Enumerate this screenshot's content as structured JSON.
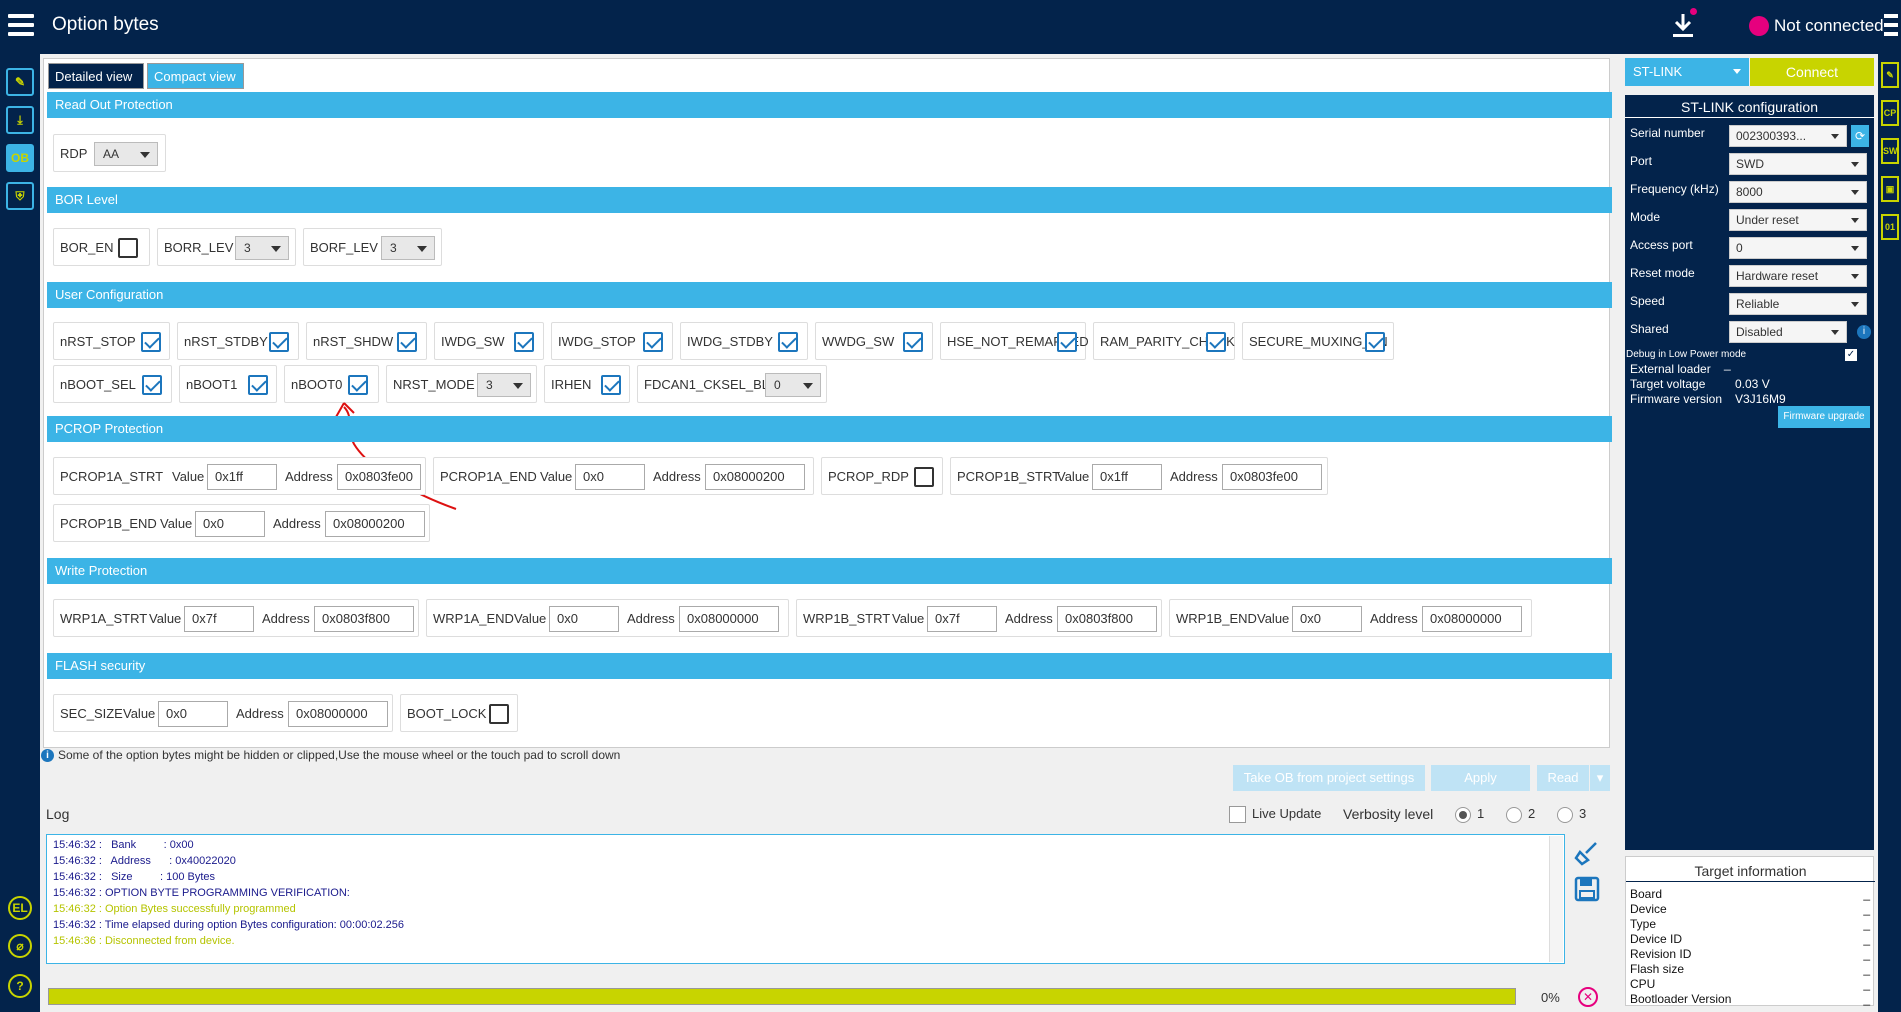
{
  "header": {
    "title": "Option bytes",
    "connection_status": "Not connected"
  },
  "tabs": {
    "detailed": "Detailed view",
    "compact": "Compact view"
  },
  "sections": {
    "rdp": "Read Out Protection",
    "bor": "BOR Level",
    "user": "User Configuration",
    "pcrop": "PCROP Protection",
    "wrp": "Write Protection",
    "flash": "FLASH security"
  },
  "rdp": {
    "label": "RDP",
    "value": "AA"
  },
  "bor": {
    "bor_en": "BOR_EN",
    "borr_lev": "BORR_LEV",
    "borr_val": "3",
    "borf_lev": "BORF_LEV",
    "borf_val": "3"
  },
  "user": {
    "row1": [
      "nRST_STOP",
      "nRST_STDBY",
      "nRST_SHDW",
      "IWDG_SW",
      "IWDG_STOP",
      "IWDG_STDBY",
      "WWDG_SW",
      "HSE_NOT_REMAPPED",
      "RAM_PARITY_CHECK",
      "SECURE_MUXING_EN"
    ],
    "nboot_sel": "nBOOT_SEL",
    "nboot1": "nBOOT1",
    "nboot0": "nBOOT0",
    "nrst_mode": "NRST_MODE",
    "nrst_mode_val": "3",
    "irhen": "IRHEN",
    "fdcan": "FDCAN1_CKSEL_BL",
    "fdcan_val": "0"
  },
  "common": {
    "value": "Value",
    "address": "Address"
  },
  "pcrop": {
    "p1a_strt": "PCROP1A_STRT",
    "p1a_strt_v": "0x1ff",
    "p1a_strt_a": "0x0803fe00",
    "p1a_end": "PCROP1A_END",
    "p1a_end_v": "0x0",
    "p1a_end_a": "0x08000200",
    "p_rdp": "PCROP_RDP",
    "p1b_strt": "PCROP1B_STRT",
    "p1b_strt_v": "0x1ff",
    "p1b_strt_a": "0x0803fe00",
    "p1b_end": "PCROP1B_END",
    "p1b_end_v": "0x0",
    "p1b_end_a": "0x08000200"
  },
  "wrp": {
    "a_strt": "WRP1A_STRT",
    "a_strt_v": "0x7f",
    "a_strt_a": "0x0803f800",
    "a_end": "WRP1A_END",
    "a_end_v": "0x0",
    "a_end_a": "0x08000000",
    "b_strt": "WRP1B_STRT",
    "b_strt_v": "0x7f",
    "b_strt_a": "0x0803f800",
    "b_end": "WRP1B_END",
    "b_end_v": "0x0",
    "b_end_a": "0x08000000"
  },
  "flash": {
    "sec_size": "SEC_SIZE",
    "sec_v": "0x0",
    "sec_a": "0x08000000",
    "boot_lock": "BOOT_LOCK"
  },
  "info": "Some of the option bytes might be hidden or clipped,Use the mouse wheel or the touch pad to scroll down",
  "buttons": {
    "take_ob": "Take OB from project settings",
    "apply": "Apply",
    "read": "Read"
  },
  "log": {
    "title": "Log",
    "live_update": "Live Update",
    "verbosity": "Verbosity level",
    "v1": "1",
    "v2": "2",
    "v3": "3",
    "lines": [
      {
        "text": "15:46:32 :   Bank         : 0x00",
        "color": "#1a1a8c"
      },
      {
        "text": "15:46:32 :   Address      : 0x40022020",
        "color": "#1a1a8c"
      },
      {
        "text": "15:46:32 :   Size         : 100 Bytes",
        "color": "#1a1a8c"
      },
      {
        "text": "15:46:32 : OPTION BYTE PROGRAMMING VERIFICATION:",
        "color": "#1a1a8c"
      },
      {
        "text": "15:46:32 : Option Bytes successfully programmed",
        "color": "#b5c400"
      },
      {
        "text": "15:46:32 : Time elapsed during option Bytes configuration: 00:00:02.256",
        "color": "#1a1a8c"
      },
      {
        "text": "15:46:36 : Disconnected from device.",
        "color": "#b5c400"
      }
    ]
  },
  "progress": {
    "percent": "0%"
  },
  "side": {
    "probe": "ST-LINK",
    "connect": "Connect",
    "config_title": "ST-LINK configuration",
    "serial_lbl": "Serial number",
    "serial_val": "002300393...",
    "port_lbl": "Port",
    "port_val": "SWD",
    "freq_lbl": "Frequency (kHz)",
    "freq_val": "8000",
    "mode_lbl": "Mode",
    "mode_val": "Under reset",
    "ap_lbl": "Access port",
    "ap_val": "0",
    "reset_lbl": "Reset mode",
    "reset_val": "Hardware reset",
    "speed_lbl": "Speed",
    "speed_val": "Reliable",
    "shared_lbl": "Shared",
    "shared_val": "Disabled",
    "debug_lp": "Debug in Low Power mode",
    "ext_loader": "External loader",
    "ext_loader_val": "_",
    "tv_lbl": "Target voltage",
    "tv_val": "0.03 V",
    "fw_lbl": "Firmware version",
    "fw_val": "V3J16M9",
    "fw_upgrade": "Firmware upgrade"
  },
  "target": {
    "title": "Target information",
    "rows": [
      {
        "k": "Board",
        "v": "_"
      },
      {
        "k": "Device",
        "v": "_"
      },
      {
        "k": "Type",
        "v": "_"
      },
      {
        "k": "Device ID",
        "v": "_"
      },
      {
        "k": "Revision ID",
        "v": "_"
      },
      {
        "k": "Flash size",
        "v": "_"
      },
      {
        "k": "CPU",
        "v": "_"
      },
      {
        "k": "Bootloader Version",
        "v": "_"
      }
    ]
  },
  "leftbar": {
    "ob": "OB",
    "el": "EL"
  },
  "rightbar": {
    "cp": "CP",
    "sw": "SW",
    "b01": "01"
  }
}
